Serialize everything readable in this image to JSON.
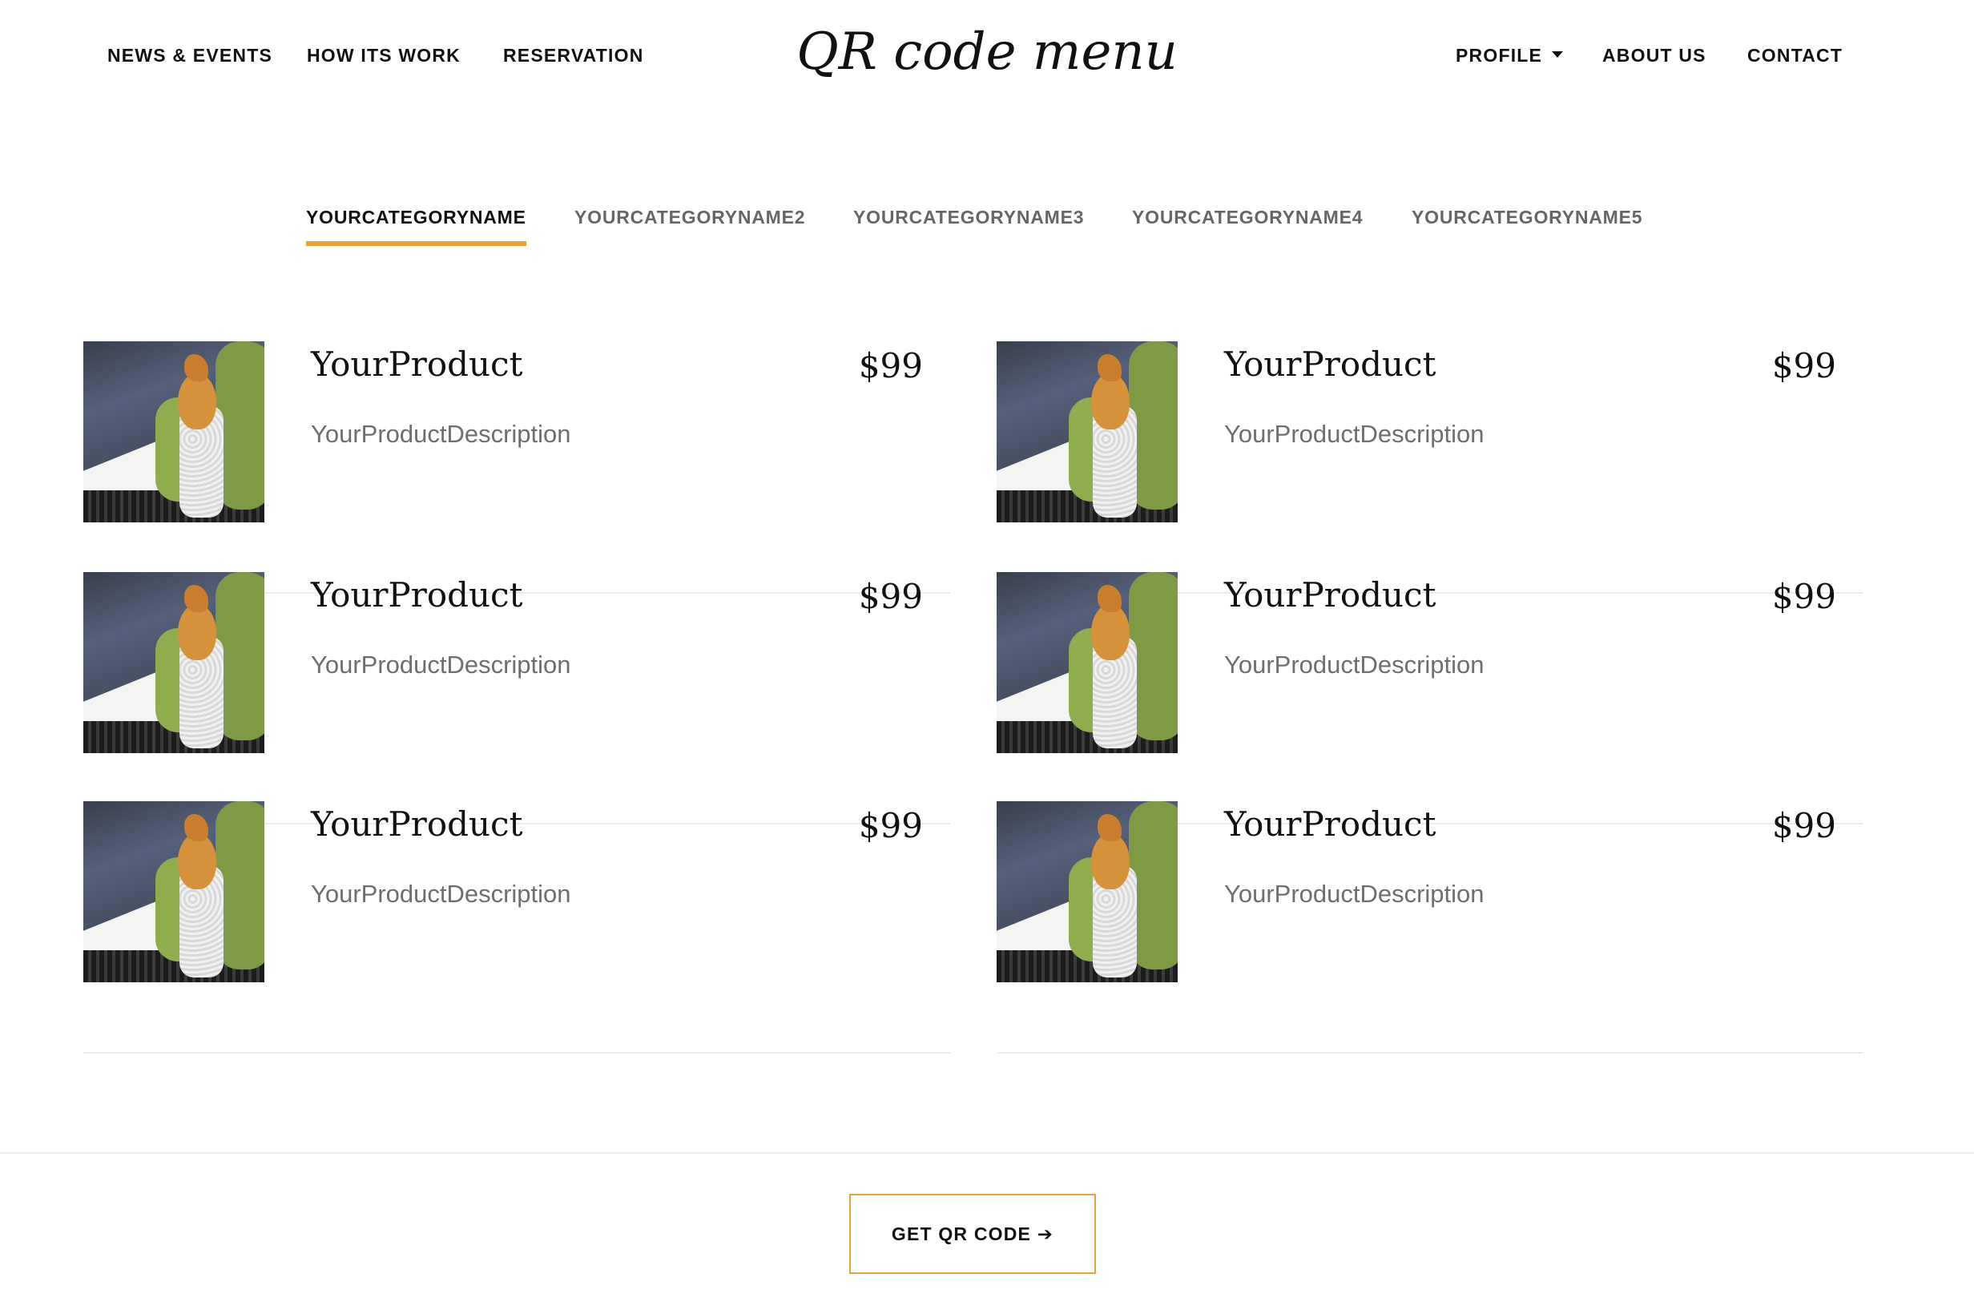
{
  "nav": {
    "left": [
      {
        "label": "NEWS & EVENTS"
      },
      {
        "label": "HOW ITS WORK"
      },
      {
        "label": "RESERVATION"
      }
    ],
    "brand": "QR code menu",
    "right": [
      {
        "label": "PROFILE",
        "has_dropdown": true
      },
      {
        "label": "ABOUT US"
      },
      {
        "label": "CONTACT"
      }
    ]
  },
  "tabs": [
    {
      "label": "YOURCATEGORYNAME",
      "active": true
    },
    {
      "label": "YOURCATEGORYNAME2",
      "active": false
    },
    {
      "label": "YOURCATEGORYNAME3",
      "active": false
    },
    {
      "label": "YOURCATEGORYNAME4",
      "active": false
    },
    {
      "label": "YOURCATEGORYNAME5",
      "active": false
    }
  ],
  "products": [
    {
      "name": "YourProduct",
      "price": "$99",
      "description": "YourProductDescription",
      "image": "sushi-roll-photo"
    },
    {
      "name": "YourProduct",
      "price": "$99",
      "description": "YourProductDescription",
      "image": "sushi-roll-photo"
    },
    {
      "name": "YourProduct",
      "price": "$99",
      "description": "YourProductDescription",
      "image": "sushi-roll-photo"
    },
    {
      "name": "YourProduct",
      "price": "$99",
      "description": "YourProductDescription",
      "image": "sushi-roll-photo"
    },
    {
      "name": "YourProduct",
      "price": "$99",
      "description": "YourProductDescription",
      "image": "sushi-roll-photo"
    },
    {
      "name": "YourProduct",
      "price": "$99",
      "description": "YourProductDescription",
      "image": "sushi-roll-photo"
    }
  ],
  "footer": {
    "cta_label": "GET QR CODE ➔"
  },
  "colors": {
    "accent": "#e9a23b",
    "text": "#111111",
    "muted": "#6e6e6e",
    "divider": "#ececec"
  }
}
